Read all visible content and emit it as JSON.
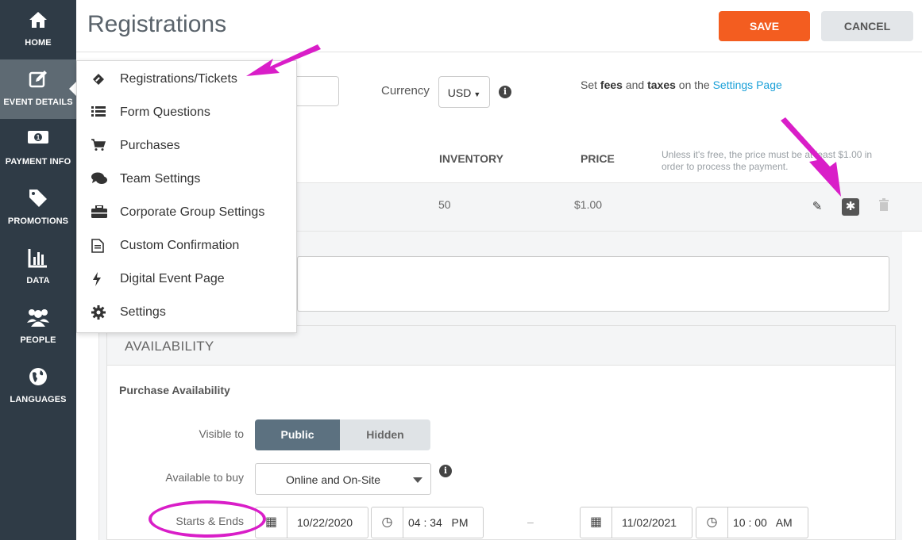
{
  "sidebar": {
    "items": [
      {
        "label": "HOME",
        "icon": "home-icon"
      },
      {
        "label": "EVENT DETAILS",
        "icon": "edit-icon"
      },
      {
        "label": "PAYMENT INFO",
        "icon": "money-icon"
      },
      {
        "label": "PROMOTIONS",
        "icon": "tag-icon"
      },
      {
        "label": "DATA",
        "icon": "bar-chart-icon"
      },
      {
        "label": "PEOPLE",
        "icon": "people-icon"
      },
      {
        "label": "LANGUAGES",
        "icon": "globe-icon"
      }
    ]
  },
  "header": {
    "title": "Registrations",
    "save_label": "SAVE",
    "cancel_label": "CANCEL"
  },
  "menu": {
    "items": [
      {
        "label": "Registrations/Tickets",
        "icon": "ticket-icon"
      },
      {
        "label": "Form Questions",
        "icon": "list-icon"
      },
      {
        "label": "Purchases",
        "icon": "cart-icon"
      },
      {
        "label": "Team Settings",
        "icon": "chat-icon"
      },
      {
        "label": "Corporate Group Settings",
        "icon": "briefcase-icon"
      },
      {
        "label": "Custom Confirmation",
        "icon": "document-icon"
      },
      {
        "label": "Digital Event Page",
        "icon": "bolt-icon"
      },
      {
        "label": "Settings",
        "icon": "gear-icon"
      }
    ]
  },
  "currency": {
    "label": "Currency",
    "value": "USD"
  },
  "settings_note": {
    "pre": "Set ",
    "fees": "fees",
    "and": " and ",
    "taxes": "taxes",
    "post": " on the ",
    "link": "Settings Page"
  },
  "columns": {
    "inventory": "INVENTORY",
    "price": "PRICE",
    "note": "Unless it's free, the price must be at least $1.00 in order to process the payment."
  },
  "ticket": {
    "inventory": "50",
    "price": "$1.00"
  },
  "availability": {
    "title": "AVAILABILITY",
    "subtitle": "Purchase Availability",
    "visible_label": "Visible to",
    "visible_options": [
      "Public",
      "Hidden"
    ],
    "available_label": "Available to buy",
    "available_value": "Online and On-Site",
    "starts_label": "Starts & Ends",
    "start_date": "10/22/2020",
    "start_time": "04 : 34   PM",
    "end_date": "11/02/2021",
    "end_time": "10 : 00   AM"
  },
  "colors": {
    "sidebar": "#2f3b46",
    "save": "#f35d20",
    "accent_annotation": "#d91ec8",
    "link": "#1aa0d8",
    "toggle_active": "#5c7180"
  }
}
